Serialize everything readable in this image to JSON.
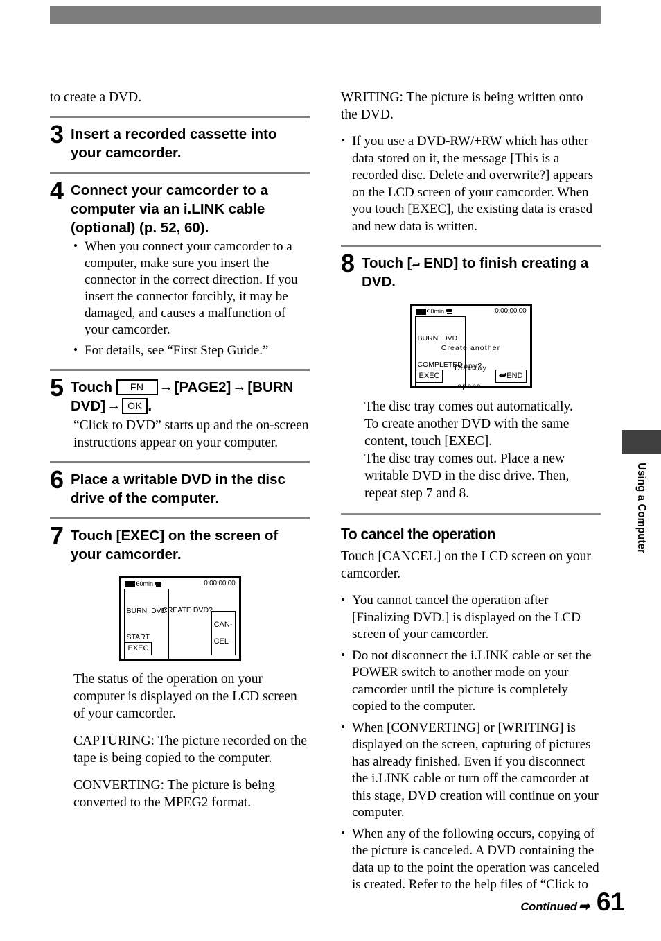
{
  "page": {
    "number": "61",
    "continued_label": "Continued",
    "continued_arrow": "➡",
    "side_tab_label": "Using a Computer"
  },
  "left_column": {
    "intro_text": "to create a DVD.",
    "steps": [
      {
        "number": "3",
        "title": "Insert a recorded cassette into your camcorder."
      },
      {
        "number": "4",
        "title": "Connect your camcorder to a computer via an i.LINK cable (optional) (p. 52, 60).",
        "bullets": [
          "When you connect your camcorder to a computer, make sure you insert the connector in the correct direction. If you insert the connector forcibly, it may be damaged, and causes a malfunction of your camcorder.",
          "For details, see “First Step Guide.”"
        ]
      },
      {
        "number": "5",
        "title_parts": {
          "touch": "Touch",
          "key_fn": "FN",
          "arrow1": "→",
          "page2": "[PAGE2]",
          "arrow2": "→",
          "burn_dvd": "[BURN DVD]",
          "arrow3": "→",
          "key_ok": "OK",
          "period": "."
        },
        "body": "“Click to DVD” starts up and the on-screen instructions appear on your computer."
      },
      {
        "number": "6",
        "title": "Place a writable DVD in the disc drive of the computer."
      },
      {
        "number": "7",
        "title": "Touch [EXEC] on the screen of your camcorder."
      }
    ],
    "lcd_start": {
      "battery_time": "60min",
      "timecode": "0:00:00:00",
      "status_line1": "BURN  DVD",
      "status_line2": "START",
      "message": "CREATE DVD?",
      "button_left": "EXEC",
      "button_right_line1": "CAN-",
      "button_right_line2": "CEL"
    },
    "after_lcd_paragraphs": [
      "The status of the operation on your computer is displayed on the LCD screen of your camcorder.",
      "CAPTURING: The picture recorded on the tape is being copied to the computer.",
      "CONVERTING: The picture is being converted to the MPEG2 format."
    ]
  },
  "right_column": {
    "writing_paragraph": "WRITING: The picture is being written onto the DVD.",
    "writing_bullets": [
      "If you use a DVD-RW/+RW which has other data stored on it, the message [This is a recorded disc. Delete and overwrite?] appears on the LCD screen of your camcorder. When you touch [EXEC], the existing data is erased and new data is written."
    ],
    "step8": {
      "number": "8",
      "title_prefix": "Touch [",
      "title_icon": "return-arrow",
      "title_suffix": " END] to finish creating a DVD."
    },
    "lcd_completed": {
      "battery_time": "60min",
      "timecode": "0:00:00:00",
      "status_line1": "BURN  DVD",
      "status_line2": "COMPLETED",
      "message_line1": "Create another",
      "message_line2": "copy?",
      "message_line3": "Disctray",
      "message_line4": "opens.",
      "button_left": "EXEC",
      "button_right": "END"
    },
    "after_lcd_paragraph": "The disc tray comes out automatically.\nTo create another DVD with the same content, touch [EXEC].\nThe disc tray comes out. Place a new writable DVD in the disc drive. Then, repeat step 7 and 8.",
    "cancel_section": {
      "heading": "To cancel the operation",
      "body": "Touch [CANCEL] on the LCD screen on your camcorder.",
      "bullets": [
        "You cannot cancel the operation after [Finalizing DVD.] is displayed on the LCD screen of your camcorder.",
        "Do not disconnect the i.LINK cable or set the POWER switch to another mode on your camcorder until the picture is completely copied to the computer.",
        "When [CONVERTING] or [WRITING] is displayed on the screen, capturing of pictures has already finished. Even if you disconnect the i.LINK cable or turn off the camcorder at this stage, DVD creation will continue on your computer.",
        "When any of the following occurs, copying of the picture is canceled. A DVD containing the data up to the point the operation was canceled is created. Refer to the help files of “Click to"
      ]
    }
  },
  "colors": {
    "band": "#7d7d7d",
    "rule": "#808080",
    "side_tab": "#3f3f3f"
  }
}
